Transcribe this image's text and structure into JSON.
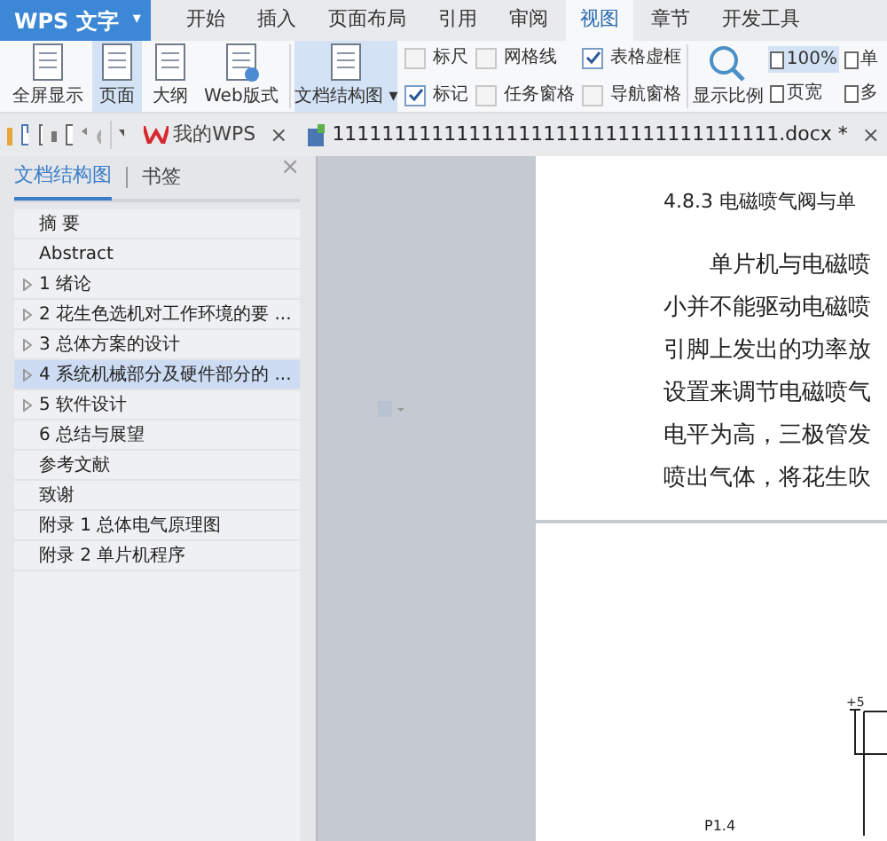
{
  "app_menu": {
    "label": "WPS 文字",
    "caret": "▾"
  },
  "ribbon_tabs": [
    {
      "label": "开始",
      "selected": false
    },
    {
      "label": "插入",
      "selected": false
    },
    {
      "label": "页面布局",
      "selected": false
    },
    {
      "label": "引用",
      "selected": false
    },
    {
      "label": "审阅",
      "selected": false
    },
    {
      "label": "视图",
      "selected": true
    },
    {
      "label": "章节",
      "selected": false
    },
    {
      "label": "开发工具",
      "selected": false
    }
  ],
  "view_buttons": [
    {
      "label": "全屏显示",
      "selected": false
    },
    {
      "label": "页面",
      "selected": true
    },
    {
      "label": "大纲",
      "selected": false
    },
    {
      "label": "Web版式",
      "selected": false
    }
  ],
  "doc_map_button": {
    "label": "文档结构图",
    "caret": "▾",
    "selected": true
  },
  "checkboxes": [
    {
      "label": "标尺",
      "checked": false
    },
    {
      "label": "网格线",
      "checked": false
    },
    {
      "label": "表格虚框",
      "checked": true
    },
    {
      "label": "标记",
      "checked": true
    },
    {
      "label": "任务窗格",
      "checked": false
    },
    {
      "label": "导航窗格",
      "checked": false
    }
  ],
  "zoom_button": {
    "label": "显示比例"
  },
  "zoom_options": [
    {
      "label": "100%",
      "selected": true
    },
    {
      "label": "单",
      "selected": false
    },
    {
      "label": "页宽",
      "selected": false
    },
    {
      "label": "多",
      "selected": false
    }
  ],
  "doc_tabs": [
    {
      "label": "我的WPS",
      "close": "×",
      "selected": false
    },
    {
      "label": "111111111111111111111111111111111111.docx *",
      "close": "×",
      "selected": true
    }
  ],
  "sidebar": {
    "tabs": [
      {
        "label": "文档结构图",
        "selected": true
      },
      {
        "label": "书签",
        "selected": false
      }
    ],
    "close": "×",
    "items": [
      {
        "label": "摘 要",
        "expandable": false,
        "selected": false
      },
      {
        "label": "Abstract",
        "expandable": false,
        "selected": false
      },
      {
        "label": "1 绪论",
        "expandable": true,
        "selected": false
      },
      {
        "label": "2 花生色选机对工作环境的要 ...",
        "expandable": true,
        "selected": false
      },
      {
        "label": "3 总体方案的设计",
        "expandable": true,
        "selected": false
      },
      {
        "label": "4 系统机械部分及硬件部分的 ...",
        "expandable": true,
        "selected": true
      },
      {
        "label": "5 软件设计",
        "expandable": true,
        "selected": false
      },
      {
        "label": "6 总结与展望",
        "expandable": false,
        "selected": false
      },
      {
        "label": "参考文献",
        "expandable": false,
        "selected": false
      },
      {
        "label": "致谢",
        "expandable": false,
        "selected": false
      },
      {
        "label": "附录 1  总体电气原理图",
        "expandable": false,
        "selected": false
      },
      {
        "label": "附录 2  单片机程序",
        "expandable": false,
        "selected": false
      }
    ]
  },
  "document": {
    "heading": "4.8.3  电磁喷气阀与单",
    "paragraph_lines": [
      "单片机与电磁喷",
      "小并不能驱动电磁喷",
      "引脚上发出的功率放",
      "设置来调节电磁喷气",
      "电平为高，三极管发",
      "喷出气体，将花生吹"
    ],
    "circuit_labels": [
      "+5",
      "P1.4"
    ]
  }
}
